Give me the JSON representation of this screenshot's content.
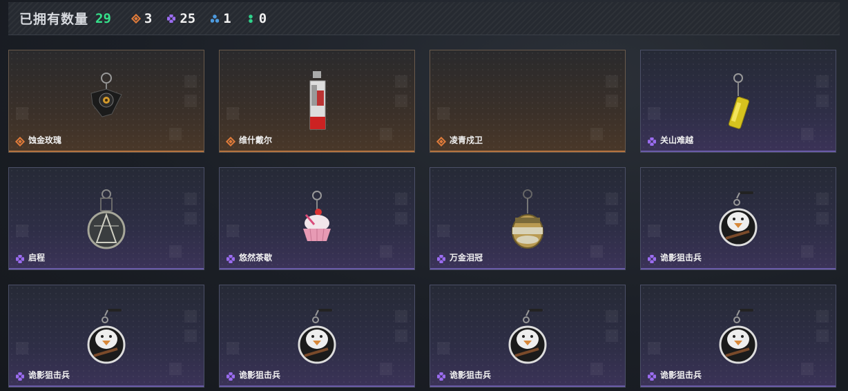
{
  "header": {
    "owned_label": "已拥有数量",
    "owned_count": "29",
    "stats": [
      {
        "icon": "orange-diamond-icon",
        "value": "3"
      },
      {
        "icon": "purple-diamond-icon",
        "value": "25"
      },
      {
        "icon": "blue-diamond-icon",
        "value": "1"
      },
      {
        "icon": "green-dots-icon",
        "value": "0"
      }
    ]
  },
  "colors": {
    "owned_count": "#35e08a",
    "orange_tier": "#e07b3a",
    "purple_tier": "#9b6cf0",
    "blue_tier": "#4d9be0",
    "green_tier": "#2fd28b"
  },
  "items": [
    {
      "name": "蚀金玫瑰",
      "tier": "orange",
      "art": "rose-pendant"
    },
    {
      "name": "维什戴尔",
      "tier": "orange",
      "art": "tag-pendant"
    },
    {
      "name": "凌青戍卫",
      "tier": "orange",
      "art": "none"
    },
    {
      "name": "关山难越",
      "tier": "purple",
      "art": "can-pendant"
    },
    {
      "name": "启程",
      "tier": "purple",
      "art": "medal-pendant"
    },
    {
      "name": "悠然茶歇",
      "tier": "purple",
      "art": "cupcake-pendant"
    },
    {
      "name": "万金泪冠",
      "tier": "purple",
      "art": "ornament-pendant"
    },
    {
      "name": "诡影狙击兵",
      "tier": "purple",
      "art": "goose-pendant"
    },
    {
      "name": "诡影狙击兵",
      "tier": "purple",
      "art": "goose-pendant"
    },
    {
      "name": "诡影狙击兵",
      "tier": "purple",
      "art": "goose-pendant"
    },
    {
      "name": "诡影狙击兵",
      "tier": "purple",
      "art": "goose-pendant"
    },
    {
      "name": "诡影狙击兵",
      "tier": "purple",
      "art": "goose-pendant"
    }
  ]
}
